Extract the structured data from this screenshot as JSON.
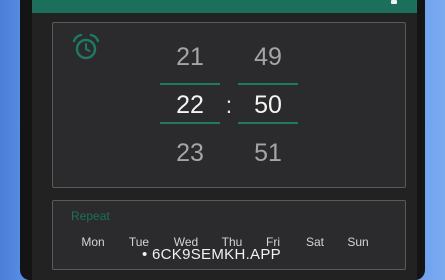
{
  "colors": {
    "accent": "#1d7a63",
    "appbar": "#1b6f5b",
    "card_background": "#2b2b2d",
    "selected_text": "#f4f4f4",
    "dim_text": "#a5a5a5"
  },
  "appbar": {
    "action_icon": "overflow-icon"
  },
  "time_picker": {
    "icon": "alarm-clock-icon",
    "hours": {
      "prev": "21",
      "selected": "22",
      "next": "23"
    },
    "minutes": {
      "prev": "49",
      "selected": "50",
      "next": "51"
    },
    "separator": ":"
  },
  "repeat": {
    "label": "Repeat",
    "days": [
      "Mon",
      "Tue",
      "Wed",
      "Thu",
      "Fri",
      "Sat",
      "Sun"
    ]
  },
  "watermark": "• 6CK9SEMKH.APP"
}
